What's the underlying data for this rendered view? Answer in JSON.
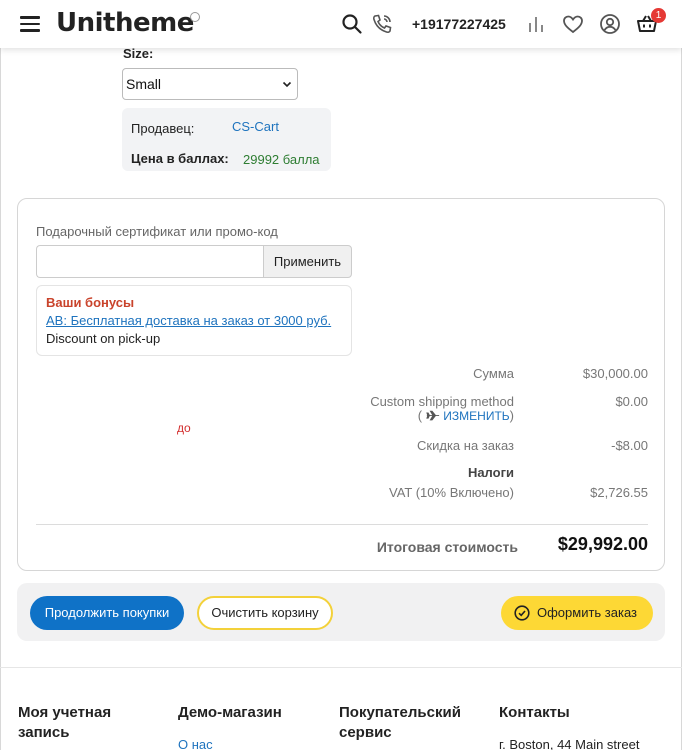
{
  "header": {
    "logo": "Unitheme",
    "phone": "+19177227425",
    "cart_count": "1"
  },
  "product": {
    "size_label": "Size:",
    "size_value": "Small",
    "vendor_label": "Продавец:",
    "vendor_value": "CS-Cart",
    "points_label": "Цена в баллах:",
    "points_value": "29992 балла"
  },
  "promo": {
    "label": "Подарочный сертификат или промо-код",
    "input_value": "",
    "apply_label": "Применить"
  },
  "bonuses": {
    "title": "Ваши бонусы",
    "link": "АВ: Бесплатная доставка на заказ от 3000 руб.",
    "text": "Discount on pick-up"
  },
  "stray_label": "до",
  "summary": {
    "subtotal_label": "Сумма",
    "subtotal_value": "$30,000.00",
    "shipping_label": "Custom shipping method",
    "shipping_change_open": "(",
    "shipping_change_link": "ИЗМЕНИТЬ",
    "shipping_change_close": ")",
    "shipping_value": "$0.00",
    "discount_label": "Скидка на заказ",
    "discount_value": "-$8.00",
    "taxes_title": "Налоги",
    "vat_label": "VAT (10% Включено)",
    "vat_value": "$2,726.55",
    "total_label": "Итоговая стоимость",
    "total_value": "$29,992.00"
  },
  "actions": {
    "continue_label": "Продолжить покупки",
    "clear_label": "Очистить корзину",
    "checkout_label": "Оформить заказ"
  },
  "footer": {
    "col1_title": "Моя учетная запись",
    "col2_title": "Демо-магазин",
    "col2_link": "О нас",
    "col3_title": "Покупательский сервис",
    "col4_title": "Контакты",
    "col4_text": "г. Boston, 44 Main street"
  },
  "colors": {
    "primary": "#0f72c7",
    "accent_yellow": "#fdd835",
    "badge_red": "#e53935",
    "bonus_red": "#c9432b",
    "points_green": "#2e7d32"
  },
  "icons": [
    "menu-icon",
    "search-icon",
    "phone-icon",
    "compare-icon",
    "heart-icon",
    "user-icon",
    "cart-icon",
    "chevron-down-icon",
    "plane-icon",
    "check-circle-icon"
  ]
}
